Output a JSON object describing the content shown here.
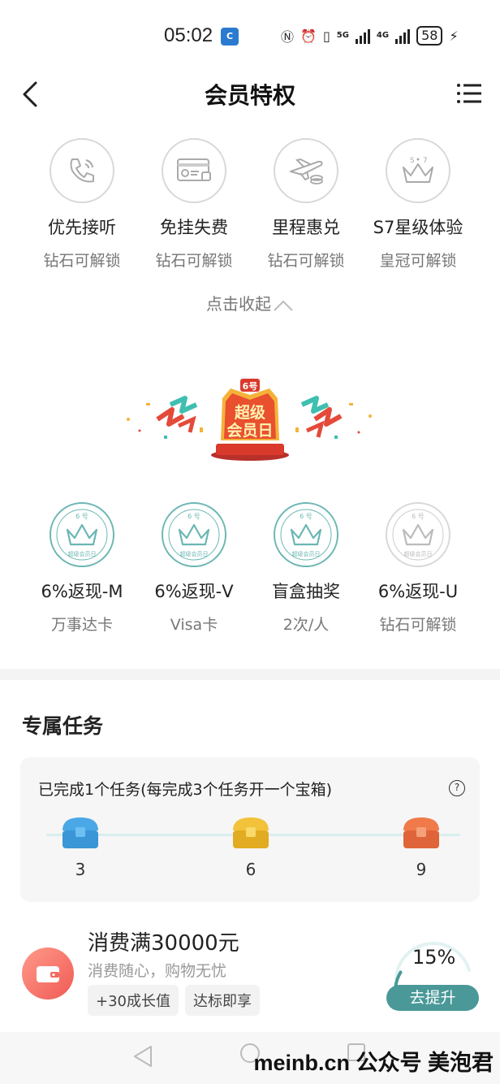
{
  "status_bar": {
    "time": "05:02",
    "app_badge": "C",
    "network1": "5G",
    "network2": "4G",
    "battery": "58"
  },
  "header": {
    "title": "会员特权"
  },
  "privileges_row1": [
    {
      "name": "优先接听",
      "sub": "钻石可解锁",
      "icon": "phone-icon"
    },
    {
      "name": "免挂失费",
      "sub": "钻石可解锁",
      "icon": "card-icon"
    },
    {
      "name": "里程惠兑",
      "sub": "钻石可解锁",
      "icon": "plane-icon"
    },
    {
      "name": "S7星级体验",
      "sub": "皇冠可解锁",
      "icon": "crown-stars-icon"
    }
  ],
  "collapse_label": "点击收起",
  "banner": {
    "badge": "6号",
    "line1": "超级",
    "line2": "会员日"
  },
  "privileges_row2": [
    {
      "name": "6%返现-M",
      "sub": "万事达卡",
      "seal_top": "6  号",
      "seal_bottom": "超级会员日"
    },
    {
      "name": "6%返现-V",
      "sub": "Visa卡",
      "seal_top": "6  号",
      "seal_bottom": "超级会员日"
    },
    {
      "name": "盲盒抽奖",
      "sub": "2次/人",
      "seal_top": "6  号",
      "seal_bottom": "超级会员日"
    },
    {
      "name": "6%返现-U",
      "sub": "钻石可解锁",
      "seal_top": "6  号",
      "seal_bottom": "超级会员日"
    }
  ],
  "tasks": {
    "section_title": "专属任务",
    "progress_text": "已完成1个任务(每完成3个任务开一个宝箱)",
    "help_symbol": "?",
    "chests": [
      {
        "count": "3",
        "color": "#4aa8e6"
      },
      {
        "count": "6",
        "color": "#f2c23a"
      },
      {
        "count": "9",
        "color": "#f07a4a"
      }
    ],
    "item": {
      "name": "消费满30000元",
      "sub": "消费随心，购物无忧",
      "tags": [
        "+30成长值",
        "达标即享"
      ],
      "percent": "15%",
      "progress": 0.15,
      "button": "去提升"
    }
  },
  "watermark": "meinb.cn  公众号 美泡君",
  "colors": {
    "accent": "#4a9898",
    "teal_border": "#6bb7b3",
    "banner_red": "#d93a2b",
    "banner_gold": "#f5b23a"
  }
}
